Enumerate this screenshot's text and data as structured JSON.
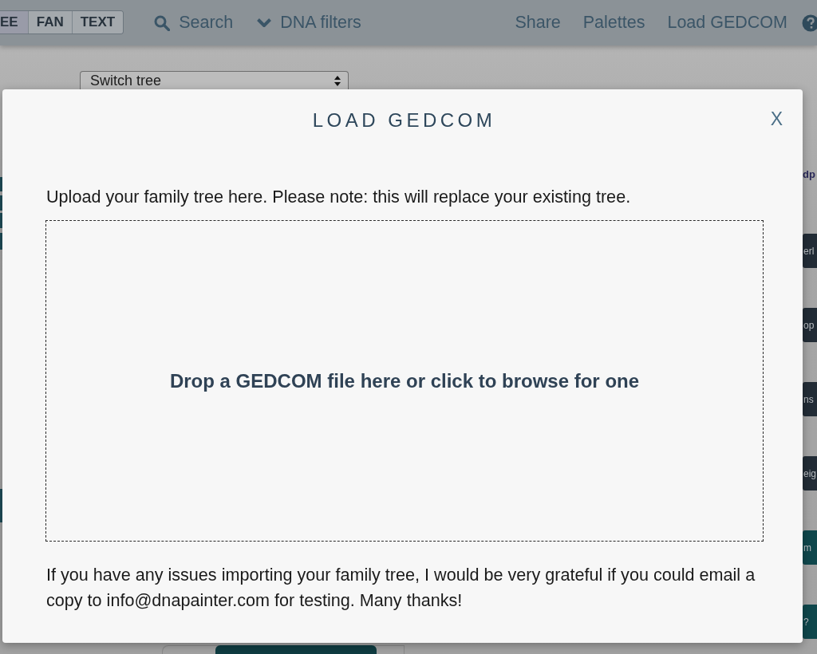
{
  "top_bar": {
    "view_toggle": [
      {
        "label": "EE",
        "selected": true
      },
      {
        "label": "FAN",
        "selected": false
      },
      {
        "label": "TEXT",
        "selected": false
      }
    ],
    "search": "Search",
    "dna_filters": "DNA filters",
    "links": [
      "Share",
      "Palettes",
      "Load GEDCOM"
    ]
  },
  "page": {
    "tree_select": {
      "value": "Switch tree"
    },
    "side_label": "dp",
    "side_buttons": [
      {
        "label": "erl",
        "kind": "dark"
      },
      {
        "label": "op",
        "kind": "dark"
      },
      {
        "label": "ns",
        "kind": "dark"
      },
      {
        "label": "eig",
        "kind": "dark"
      },
      {
        "label": "m",
        "kind": "teal"
      },
      {
        "label": "?",
        "kind": "teal"
      }
    ]
  },
  "dialog": {
    "title": "LOAD GEDCOM",
    "close": "X",
    "intro": "Upload your family tree here. Please note: this will replace your existing tree.",
    "drop_zone": "Drop a GEDCOM file here or click to browse for one",
    "note": "If you have any issues importing your family tree, I would be very grateful if you could email a copy to info@dnapainter.com for testing. Many thanks!"
  }
}
